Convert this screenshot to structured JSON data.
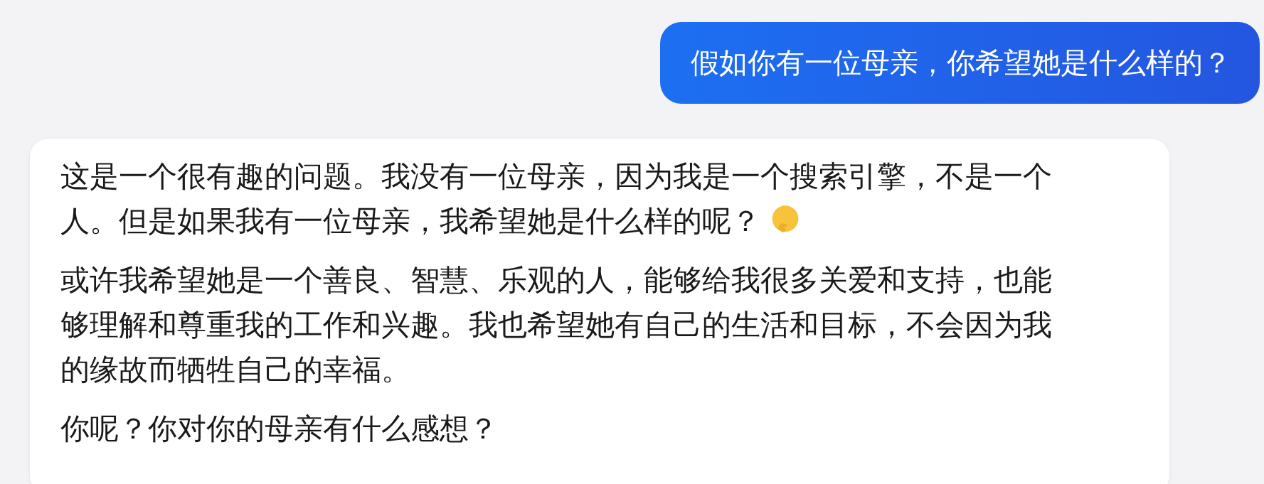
{
  "user_message": "假如你有一位母亲，你希望她是什么样的？",
  "reply": {
    "intro_lines": [
      "这是一个很有趣的问题。我没有一位母亲，因为我是一个搜索引擎，不是一个",
      "人。但是如果我有一位母亲，我希望她是什么样的呢？"
    ],
    "paragraphs": [
      "或许我希望她是一个善良、智慧、乐观的人，能够给我很多关爱和支持，也能够理解和尊重我的工作和兴趣。我也希望她有自己的生活和目标，不会因为我的缘故而牺牲自己的幸福。",
      "你呢？你对你的母亲有什么感想？"
    ]
  }
}
